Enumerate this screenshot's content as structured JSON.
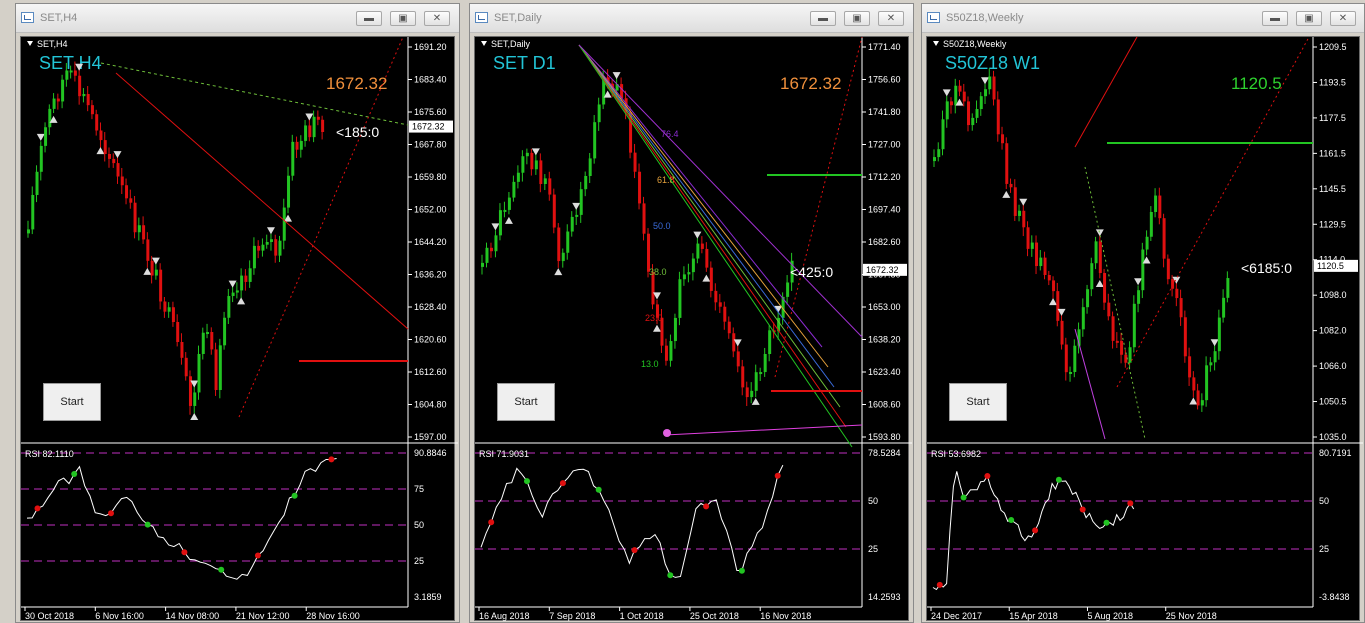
{
  "charts": [
    {
      "window_title": "SET,H4",
      "header_label": "SET,H4",
      "big_label": "SET H4",
      "big_label_color": "#22c4d6",
      "price_label": "1672.32",
      "price_label_color": "#f0903c",
      "pips_label": "<185:0",
      "current_price_tag": "1672.32",
      "price_ticks": [
        "1691.20",
        "1683.40",
        "1675.60",
        "1667.80",
        "1659.80",
        "1652.00",
        "1644.20",
        "1636.20",
        "1628.40",
        "1620.60",
        "1612.60",
        "1604.80",
        "1597.00"
      ],
      "rsi_label": "RSI 82.1110",
      "rsi_ticks": [
        "90.8846",
        "75",
        "50",
        "25",
        "3.1859"
      ],
      "date_ticks": [
        "30 Oct 2018",
        "6 Nov 16:00",
        "14 Nov 08:00",
        "21 Nov 12:00",
        "28 Nov 16:00"
      ],
      "start_label": "Start",
      "title_icon": "chart-window-icon"
    },
    {
      "window_title": "SET,Daily",
      "header_label": "SET,Daily",
      "big_label": "SET D1",
      "big_label_color": "#22c4d6",
      "price_label": "1672.32",
      "price_label_color": "#f0903c",
      "pips_label": "<425:0",
      "current_price_tag": "1672.32",
      "price_ticks": [
        "1771.40",
        "1756.60",
        "1741.80",
        "1727.00",
        "1712.20",
        "1697.40",
        "1682.60",
        "1667.80",
        "1653.00",
        "1638.20",
        "1623.40",
        "1608.60",
        "1593.80"
      ],
      "fan_labels": [
        "76.4",
        "61.8",
        "50.0",
        "38.0",
        "23.0",
        "13.0"
      ],
      "rsi_label": "RSI 71.9031",
      "rsi_ticks": [
        "78.5284",
        "50",
        "25",
        "14.2593"
      ],
      "date_ticks": [
        "16 Aug 2018",
        "7 Sep 2018",
        "1 Oct 2018",
        "25 Oct 2018",
        "16 Nov 2018"
      ],
      "start_label": "Start",
      "title_icon": "chart-window-icon"
    },
    {
      "window_title": "S50Z18,Weekly",
      "header_label": "S50Z18,Weekly",
      "big_label": "S50Z18 W1",
      "big_label_color": "#22c4d6",
      "price_label": "1120.5",
      "price_label_color": "#2ed12e",
      "pips_label": "<6185:0",
      "current_price_tag": "1120.5",
      "price_ticks": [
        "1209.5",
        "1193.5",
        "1177.5",
        "1161.5",
        "1145.5",
        "1129.5",
        "1114.0",
        "1098.0",
        "1082.0",
        "1066.0",
        "1050.5",
        "1035.0"
      ],
      "rsi_label": "RSI 53.6982",
      "rsi_ticks": [
        "80.7191",
        "50",
        "25",
        "-3.8438"
      ],
      "date_ticks": [
        "24 Dec 2017",
        "15 Apr 2018",
        "5 Aug 2018",
        "25 Nov 2018"
      ],
      "start_label": "Start",
      "title_icon": "chart-window-icon"
    }
  ],
  "window_buttons": {
    "minimize": "▬",
    "maximize": "▣",
    "close": "✕"
  },
  "colors": {
    "bull": "#22c422",
    "bear": "#e01010",
    "price_scale_text": "#ffffff",
    "grid_dash": "#c030c0"
  }
}
